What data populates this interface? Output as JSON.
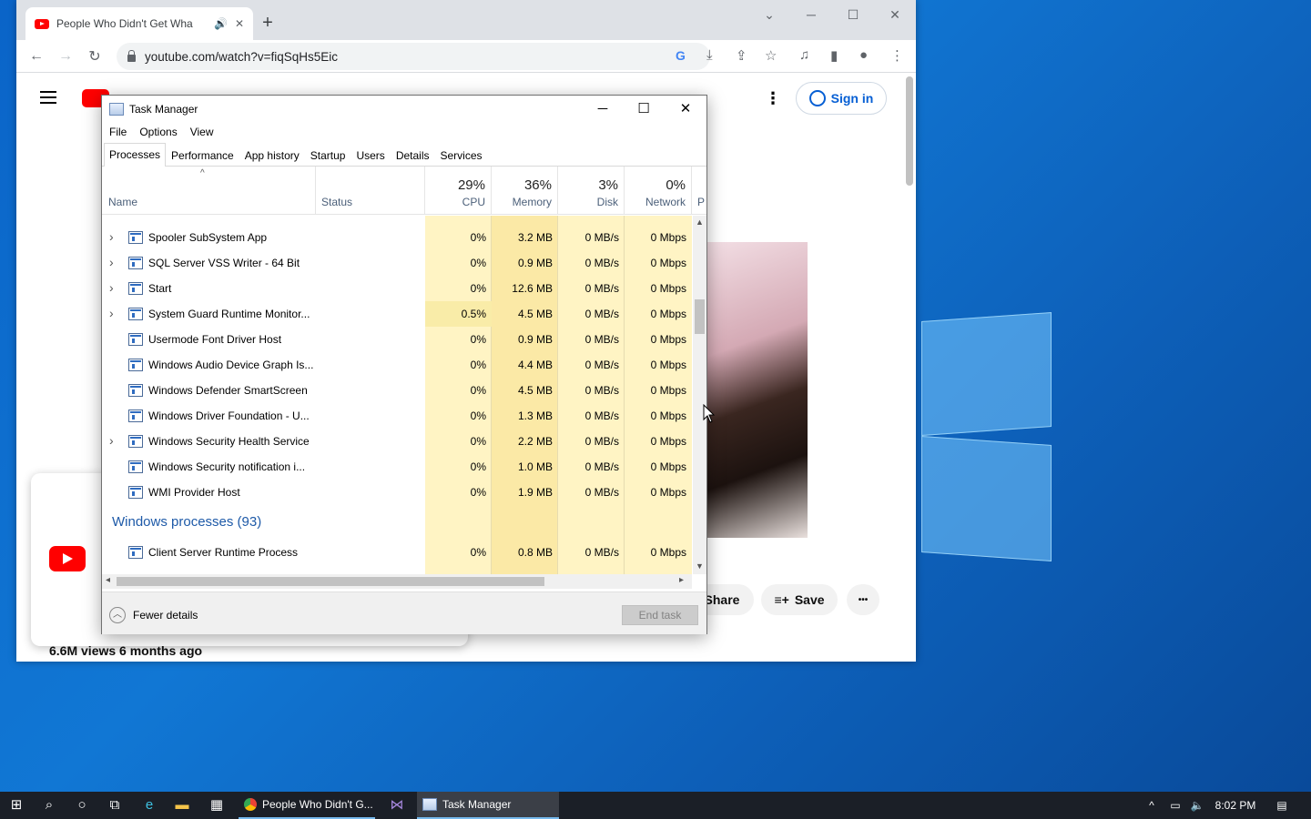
{
  "browser": {
    "tab_title": "People Who Didn't Get Wha",
    "url": "youtube.com/watch?v=fiqSqHs5Eic",
    "new_tab": "+",
    "controls": {
      "minimize": "─",
      "maximize": "☐",
      "close": "✕",
      "chevron": "⌄"
    }
  },
  "youtube": {
    "signin": "Sign in",
    "share": "Share",
    "save": "Save",
    "more": "•••",
    "views": "6.6M views  6 months ago"
  },
  "taskmanager": {
    "title": "Task Manager",
    "menu": [
      "File",
      "Options",
      "View"
    ],
    "tabs": [
      "Processes",
      "Performance",
      "App history",
      "Startup",
      "Users",
      "Details",
      "Services"
    ],
    "columns": {
      "name": "Name",
      "status": "Status",
      "cpu": {
        "pct": "29%",
        "label": "CPU"
      },
      "memory": {
        "pct": "36%",
        "label": "Memory"
      },
      "disk": {
        "pct": "3%",
        "label": "Disk"
      },
      "network": {
        "pct": "0%",
        "label": "Network"
      },
      "power": "P"
    },
    "rows": [
      {
        "name": "Spooler SubSystem App",
        "expand": true,
        "cpu": "0%",
        "mem": "3.2 MB",
        "disk": "0 MB/s",
        "net": "0 Mbps"
      },
      {
        "name": "SQL Server VSS Writer - 64 Bit",
        "expand": true,
        "cpu": "0%",
        "mem": "0.9 MB",
        "disk": "0 MB/s",
        "net": "0 Mbps"
      },
      {
        "name": "Start",
        "expand": true,
        "cpu": "0%",
        "mem": "12.6 MB",
        "disk": "0 MB/s",
        "net": "0 Mbps"
      },
      {
        "name": "System Guard Runtime Monitor...",
        "expand": true,
        "cpu": "0.5%",
        "mem": "4.5 MB",
        "disk": "0 MB/s",
        "net": "0 Mbps"
      },
      {
        "name": "Usermode Font Driver Host",
        "expand": false,
        "cpu": "0%",
        "mem": "0.9 MB",
        "disk": "0 MB/s",
        "net": "0 Mbps"
      },
      {
        "name": "Windows Audio Device Graph Is...",
        "expand": false,
        "cpu": "0%",
        "mem": "4.4 MB",
        "disk": "0 MB/s",
        "net": "0 Mbps"
      },
      {
        "name": "Windows Defender SmartScreen",
        "expand": false,
        "cpu": "0%",
        "mem": "4.5 MB",
        "disk": "0 MB/s",
        "net": "0 Mbps"
      },
      {
        "name": "Windows Driver Foundation - U...",
        "expand": false,
        "cpu": "0%",
        "mem": "1.3 MB",
        "disk": "0 MB/s",
        "net": "0 Mbps"
      },
      {
        "name": "Windows Security Health Service",
        "expand": true,
        "cpu": "0%",
        "mem": "2.2 MB",
        "disk": "0 MB/s",
        "net": "0 Mbps"
      },
      {
        "name": "Windows Security notification i...",
        "expand": false,
        "cpu": "0%",
        "mem": "1.0 MB",
        "disk": "0 MB/s",
        "net": "0 Mbps"
      },
      {
        "name": "WMI Provider Host",
        "expand": false,
        "cpu": "0%",
        "mem": "1.9 MB",
        "disk": "0 MB/s",
        "net": "0 Mbps"
      }
    ],
    "group_label": "Windows processes (93)",
    "group_rows": [
      {
        "name": "Client Server Runtime Process",
        "expand": false,
        "cpu": "0%",
        "mem": "0.8 MB",
        "disk": "0 MB/s",
        "net": "0 Mbps"
      }
    ],
    "fewer_details": "Fewer details",
    "end_task": "End task"
  },
  "taskbar": {
    "app_chrome": "People Who Didn't G...",
    "app_tm": "Task Manager",
    "time": "8:02 PM"
  },
  "colors": {
    "desktop": "#0a64c8",
    "taskbar": "#1b1f27",
    "youtube_red": "#ff0000",
    "cpu_heat": "#fff4c4",
    "mem_heat": "#fbe9a6",
    "link_blue": "#065fd4"
  }
}
